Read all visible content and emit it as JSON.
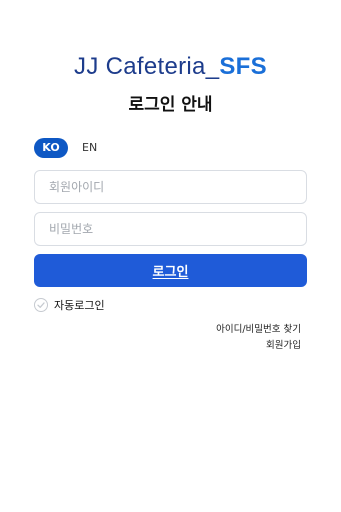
{
  "brand": {
    "name": "JJ Cafeteria_",
    "suffix": "SFS",
    "name_color": "#1d3c8c",
    "suffix_color": "#1a6fd8"
  },
  "title": "로그인 안내",
  "language": {
    "options": [
      "KO",
      "EN"
    ],
    "selected": "KO",
    "accent": "#0e58c4"
  },
  "form": {
    "id_placeholder": "회원아이디",
    "id_value": "",
    "pw_placeholder": "비밀번호",
    "pw_value": "",
    "login_label": "로그인",
    "button_color": "#1f5bd8",
    "auto_login_label": "자동로그인",
    "auto_login_checked": false,
    "check_icon": "check-circle-icon"
  },
  "links": {
    "find_account": "아이디/비밀번호 찾기",
    "signup": "회원가입"
  }
}
